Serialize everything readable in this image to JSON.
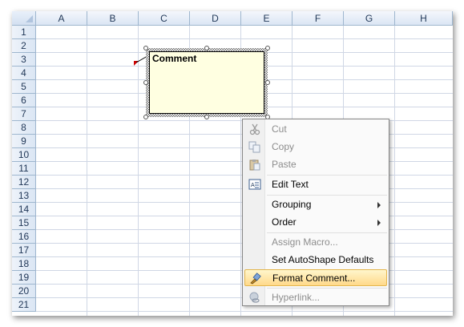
{
  "spreadsheet": {
    "columns": [
      "A",
      "B",
      "C",
      "D",
      "E",
      "F",
      "G",
      "H"
    ],
    "rows": [
      "1",
      "2",
      "3",
      "4",
      "5",
      "6",
      "7",
      "8",
      "9",
      "10",
      "11",
      "12",
      "13",
      "14",
      "15",
      "16",
      "17",
      "18",
      "19",
      "20",
      "21"
    ]
  },
  "comment": {
    "text": "Comment",
    "indicator_color": "#cc0000"
  },
  "context_menu": {
    "items": [
      {
        "label": "Cut",
        "disabled": true,
        "icon": "scissors-icon"
      },
      {
        "label": "Copy",
        "disabled": true,
        "icon": "copy-icon"
      },
      {
        "label": "Paste",
        "disabled": true,
        "icon": "clipboard-icon"
      },
      {
        "label": "Edit Text",
        "disabled": false,
        "icon": "edit-text-icon"
      },
      {
        "label": "Grouping",
        "disabled": false,
        "submenu": true
      },
      {
        "label": "Order",
        "disabled": false,
        "submenu": true
      },
      {
        "label": "Assign Macro...",
        "disabled": true
      },
      {
        "label": "Set AutoShape Defaults",
        "disabled": false
      },
      {
        "label": "Format Comment...",
        "disabled": false,
        "highlighted": true,
        "icon": "format-brush-icon"
      },
      {
        "label": "Hyperlink...",
        "disabled": true,
        "icon": "hyperlink-icon"
      }
    ]
  },
  "colors": {
    "header_text": "#1f3656",
    "gridline": "#d0d7e5",
    "comment_fill": "#ffffe1",
    "menu_highlight": "#ffd98a"
  }
}
